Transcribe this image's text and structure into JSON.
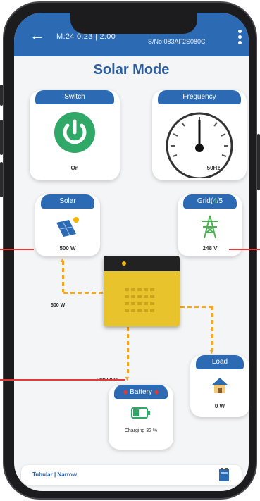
{
  "header": {
    "back_icon": "arrow-left-icon",
    "time": "M:24 0:23 | 2:00",
    "serial": "S/No:083AF2S080C",
    "menu_icon": "kebab-menu-icon"
  },
  "page_title": "Solar Mode",
  "switch_card": {
    "title": "Switch",
    "icon": "power-icon",
    "state": "On",
    "color": "#2fa868"
  },
  "frequency_card": {
    "title": "Frequency",
    "icon": "gauge-icon",
    "value": "50Hz"
  },
  "solar_card": {
    "title": "Solar",
    "icon": "solar-panel-icon",
    "value": "500 W"
  },
  "grid_card": {
    "title_prefix": "Grid(",
    "title_highlight": "4",
    "title_suffix": "/5",
    "icon": "transmission-tower-icon",
    "value": "248 V"
  },
  "flows": {
    "solar_flow": "500 W",
    "battery_flow": "300.00 W"
  },
  "battery_card": {
    "title": "Battery",
    "icon": "battery-icon",
    "status": "Charging 32 %"
  },
  "load_card": {
    "title": "Load",
    "icon": "house-icon",
    "value": "0 W"
  },
  "bottom_bar": {
    "label": "Tubular | Narrow",
    "icon": "battery-tubular-icon"
  },
  "colors": {
    "primary": "#2c6bb3",
    "flow": "#f5a623",
    "inverter": "#e8c32c",
    "annotation": "#e53935"
  }
}
